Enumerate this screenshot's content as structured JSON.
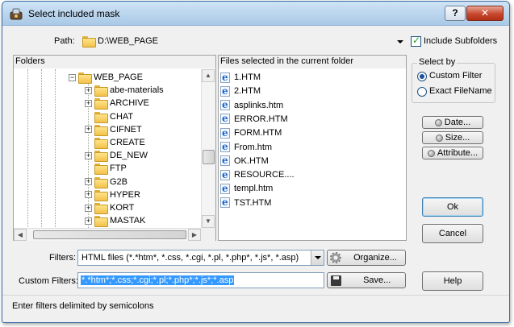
{
  "window": {
    "title": "Select included mask",
    "help_glyph": "?",
    "close_glyph": "✕"
  },
  "path": {
    "label": "Path:",
    "value": "D:\\WEB_PAGE",
    "include_subfolders_label": "Include Subfolders",
    "include_subfolders_checked": true
  },
  "folders": {
    "header": "Folders",
    "items": [
      {
        "label": "WEB_PAGE",
        "expander": "−",
        "open": true
      },
      {
        "label": "abe-materials",
        "expander": "+"
      },
      {
        "label": "ARCHIVE",
        "expander": "+"
      },
      {
        "label": "CHAT",
        "expander": ""
      },
      {
        "label": "CIFNET",
        "expander": "+"
      },
      {
        "label": "CREATE",
        "expander": ""
      },
      {
        "label": "DE_NEW",
        "expander": "+"
      },
      {
        "label": "FTP",
        "expander": ""
      },
      {
        "label": "G2B",
        "expander": "+"
      },
      {
        "label": "HYPER",
        "expander": "+"
      },
      {
        "label": "KORT",
        "expander": "+"
      },
      {
        "label": "MASTAK",
        "expander": "+"
      }
    ]
  },
  "files": {
    "header": "Files selected in the current folder",
    "items": [
      "1.HTM",
      "2.HTM",
      "asplinks.htm",
      "ERROR.HTM",
      "FORM.HTM",
      "From.htm",
      "OK.HTM",
      "RESOURCE....",
      "templ.htm",
      "TST.HTM"
    ]
  },
  "select_by": {
    "title": "Select by",
    "options": [
      {
        "label": "Custom Filter",
        "selected": true
      },
      {
        "label": "Exact FileName",
        "selected": false
      }
    ]
  },
  "side_buttons": {
    "date": "Date...",
    "size": "Size...",
    "attribute": "Attribute..."
  },
  "actions": {
    "ok": "Ok",
    "cancel": "Cancel",
    "help": "Help"
  },
  "filters": {
    "label": "Filters:",
    "value": "HTML files (*.*htm*, *.css, *.cgi, *.pl, *.php*, *.js*, *.asp)",
    "organize_label": "Organize..."
  },
  "custom_filters": {
    "label": "Custom Filters:",
    "value": "*.*htm*;*.css;*.cgi;*.pl;*.php*;*.js*;*.asp",
    "save_label": "Save..."
  },
  "status": "Enter filters delimited by semicolons",
  "colors": {
    "selection": "#3399ff",
    "accent_border": "#7f9db9",
    "default_button": "#3c7fb1"
  }
}
